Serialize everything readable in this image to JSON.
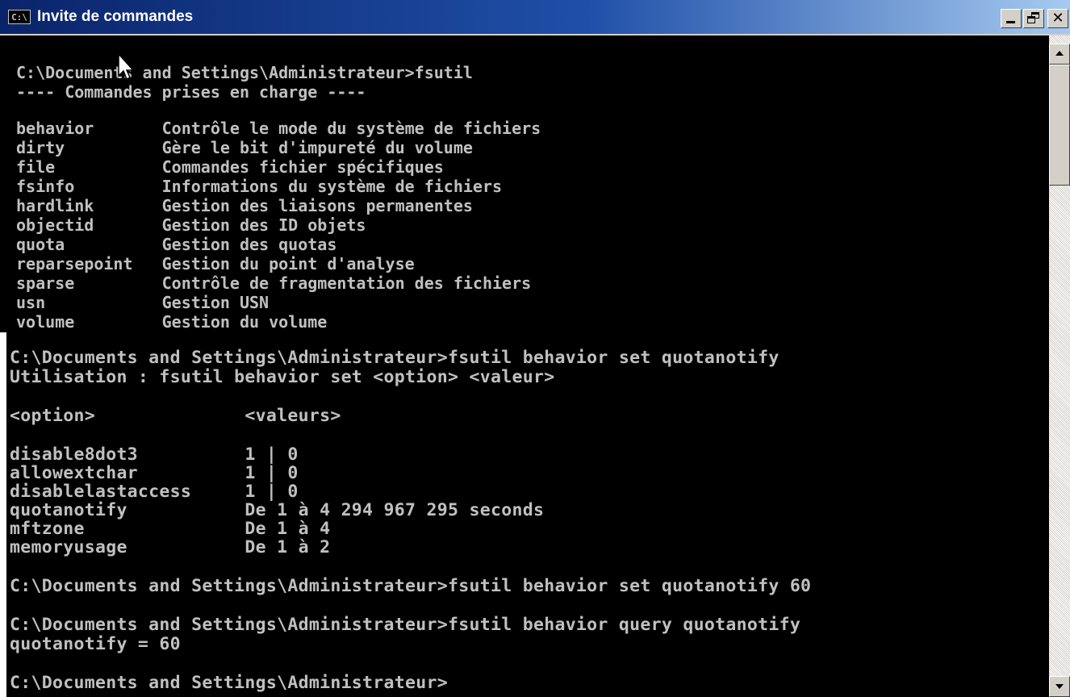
{
  "window": {
    "icon_text": "C:\\",
    "title": "Invite de commandes"
  },
  "console_top": {
    "lines": [
      "C:\\Documents and Settings\\Administrateur>fsutil",
      "---- Commandes prises en charge ----",
      "",
      "behavior       Contrôle le mode du système de fichiers",
      "dirty          Gère le bit d'impureté du volume",
      "file           Commandes fichier spécifiques",
      "fsinfo         Informations du système de fichiers",
      "hardlink       Gestion des liaisons permanentes",
      "objectid       Gestion des ID objets",
      "quota          Gestion des quotas",
      "reparsepoint   Gestion du point d'analyse",
      "sparse         Contrôle de fragmentation des fichiers",
      "usn            Gestion USN",
      "volume         Gestion du volume"
    ]
  },
  "console_bottom": {
    "lines": [
      "C:\\Documents and Settings\\Administrateur>fsutil behavior set quotanotify",
      "Utilisation : fsutil behavior set <option> <valeur>",
      "",
      "<option>              <valeurs>",
      "",
      "disable8dot3          1 | 0",
      "allowextchar          1 | 0",
      "disablelastaccess     1 | 0",
      "quotanotify           De 1 à 4 294 967 295 seconds",
      "mftzone               De 1 à 4",
      "memoryusage           De 1 à 2",
      "",
      "C:\\Documents and Settings\\Administrateur>fsutil behavior set quotanotify 60",
      "",
      "C:\\Documents and Settings\\Administrateur>fsutil behavior query quotanotify",
      "quotanotify = 60",
      "",
      "C:\\Documents and Settings\\Administrateur>"
    ]
  },
  "window_controls": {
    "close_glyph": "✕"
  },
  "colors": {
    "console_background": "#000000",
    "console_text": "#c0c0c0",
    "titlebar_start": "#0a246a",
    "titlebar_end": "#a6caf0"
  },
  "icons": {
    "app": "cmd-icon",
    "minimize": "minimize-icon",
    "maximize": "maximize-icon",
    "close": "close-icon",
    "scroll_up": "arrow-up-icon",
    "scroll_down": "arrow-down-icon",
    "cursor": "mouse-pointer-icon"
  }
}
